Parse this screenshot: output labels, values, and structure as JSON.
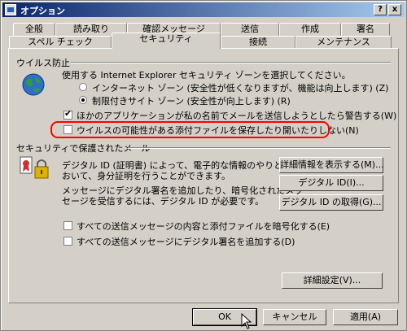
{
  "window": {
    "title": "オプション"
  },
  "titlebar_buttons": {
    "help": "?",
    "close": "x"
  },
  "tabs_row_back": [
    "全般",
    "読み取り",
    "確認メッセージ",
    "送信",
    "作成",
    "署名"
  ],
  "tabs_row_front": [
    "スペル チェック",
    "セキュリティ",
    "接続",
    "メンテナンス"
  ],
  "virus": {
    "heading": "ウイルス防止",
    "description": "使用する Internet Explorer セキュリティ ゾーンを選択してください。",
    "zone_internet": "インターネット ゾーン (安全性が低くなりますが、機能は向上します) (Z)",
    "zone_restricted": "制限付きサイト ゾーン (安全性が向上します) (R)",
    "warn_send": "ほかのアプリケーションが私の名前でメールを送信しようとしたら警告する(W)",
    "block_attach": "ウイルスの可能性がある添付ファイルを保存したり開いたりしない(N)"
  },
  "secure_mail": {
    "heading": "セキュリティで保護されたメール",
    "desc1_line1": "デジタル ID (証明書) によって、電子的な情報のやりとりに",
    "desc1_line2": "おいて、身分証明を行うことができます。",
    "desc2_line1": "メッセージにデジタル署名を追加したり、暗号化されたメッ",
    "desc2_line2": "セージを受信するには、デジタル ID が必要です。",
    "btn_details": "詳細情報を表示する(M)...",
    "btn_digital_id": "デジタル ID(I)...",
    "btn_get_id": "デジタル ID の取得(G)...",
    "encrypt_all": "すべての送信メッセージの内容と添付ファイルを暗号化する(E)",
    "sign_all": "すべての送信メッセージにデジタル署名を追加する(D)",
    "btn_advanced": "詳細設定(V)..."
  },
  "footer": {
    "ok": "OK",
    "cancel": "キャンセル",
    "apply": "適用(A)"
  },
  "state": {
    "zone_selected": "restricted",
    "warn_send_checked": true,
    "block_attach_checked": false,
    "encrypt_all_checked": false,
    "sign_all_checked": false
  },
  "colors": {
    "highlight": "#ff0000",
    "title_gradient_start": "#0a246a",
    "title_gradient_end": "#a6caf0",
    "face": "#d4d0c8"
  }
}
